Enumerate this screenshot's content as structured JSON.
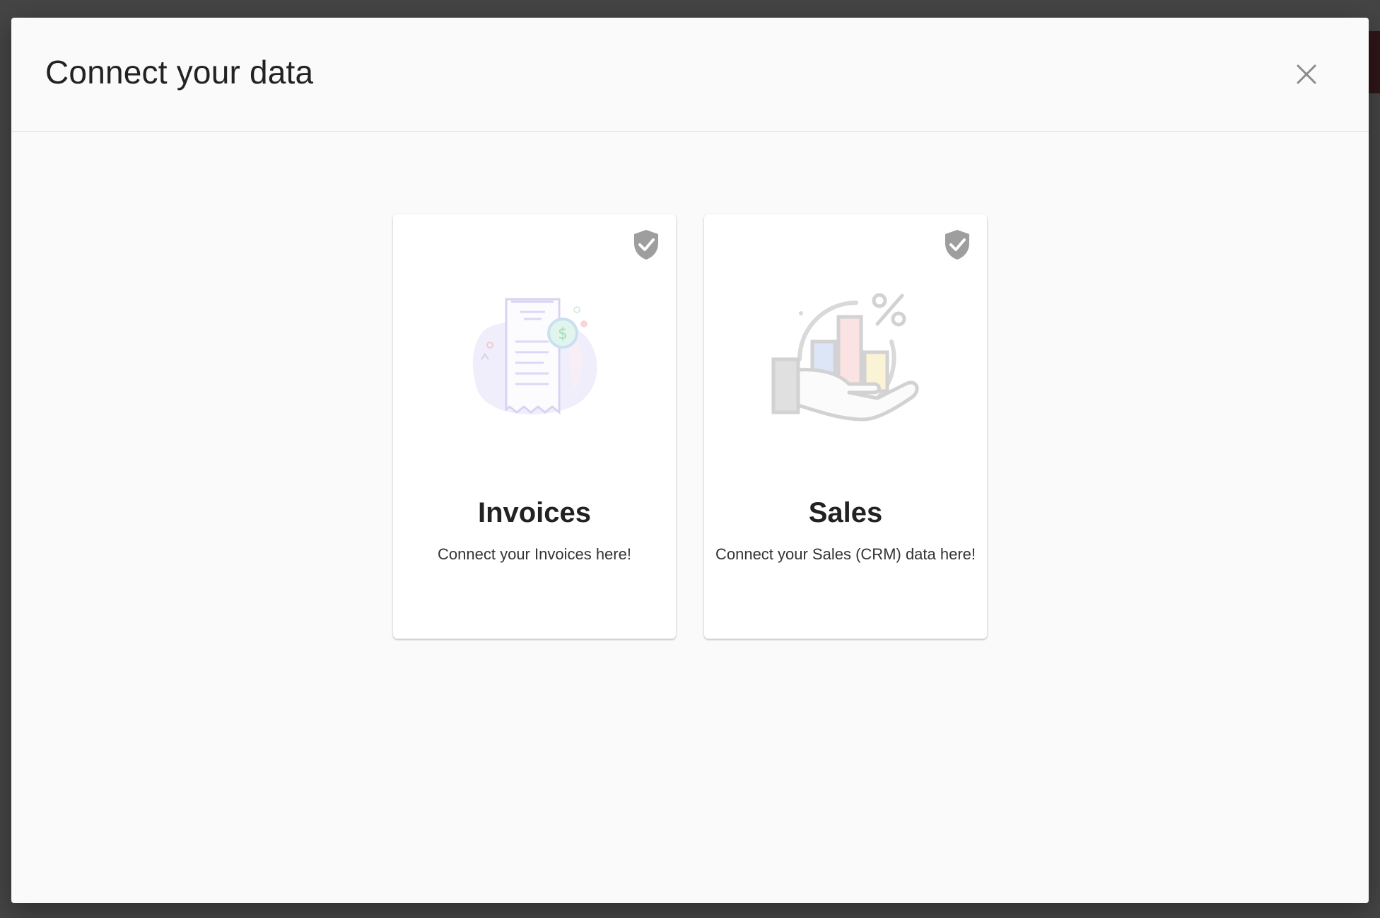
{
  "dialog": {
    "title": "Connect your data",
    "close_icon": "close-icon"
  },
  "cards": [
    {
      "title": "Invoices",
      "description": "Connect your Invoices here!",
      "status_icon": "shield-check-icon",
      "illustration": "invoice-receipt-icon"
    },
    {
      "title": "Sales",
      "description": "Connect your Sales (CRM) data here!",
      "status_icon": "shield-check-icon",
      "illustration": "sales-chart-hand-icon"
    }
  ],
  "colors": {
    "overlay": "#1f1f1f",
    "dialog_bg": "#fafafa",
    "card_bg": "#ffffff",
    "shield": "#9e9e9e",
    "peek_accent": "#8c1d24"
  }
}
